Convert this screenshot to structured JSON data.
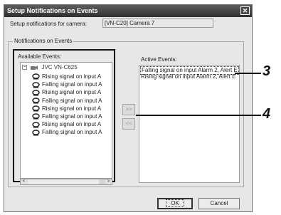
{
  "dialog": {
    "title": "Setup Notifications on Events",
    "close_glyph": "✕",
    "camera_label": "Setup notifications for camera:",
    "camera_value": "[VN-C20] Camera 7",
    "group_label": "Notifications on Events"
  },
  "available": {
    "label": "Available Events:",
    "root": "JVC VN-C625",
    "root_expander": "−",
    "items": [
      "Rising signal on input A",
      "Falling signal on input A",
      "Rising signal on input A",
      "Falling signal on input A",
      "Rising signal on input A",
      "Falling signal on input A",
      "Rising signal on input A",
      "Falling signal on input A"
    ],
    "scroll_left": "<",
    "scroll_right": ">"
  },
  "transfer": {
    "add_label": ">>",
    "remove_label": "<<"
  },
  "active": {
    "label": "Active Events:",
    "items": [
      "Falling signal on input Alarm 2, Alert E",
      "Rising signal on input Alarm 2, Alert E"
    ]
  },
  "buttons": {
    "ok": "OK",
    "cancel": "Cancel"
  },
  "callouts": {
    "three": "3",
    "four": "4"
  },
  "icons": {
    "close": "close-icon",
    "camera": "camera-icon",
    "event": "event-icon"
  }
}
